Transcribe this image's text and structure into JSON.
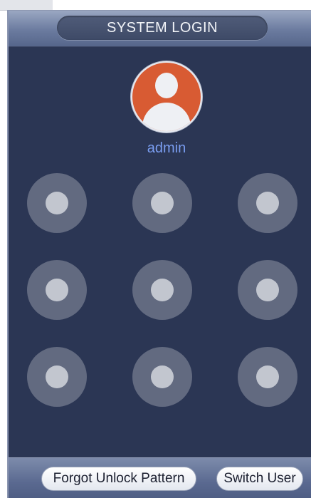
{
  "dialog": {
    "title": "SYSTEM LOGIN",
    "username": "admin"
  },
  "avatar": {
    "icon": "user-avatar-icon",
    "color": "#d85b33"
  },
  "pattern": {
    "rows": 3,
    "cols": 3,
    "dot_ids": [
      "1",
      "2",
      "3",
      "4",
      "5",
      "6",
      "7",
      "8",
      "9"
    ]
  },
  "buttons": {
    "forgot": "Forgot Unlock Pattern",
    "switch_user": "Switch User"
  },
  "colors": {
    "background": "#2b3654",
    "title_bar": "#6b7b9f",
    "username": "#7a9df0"
  }
}
